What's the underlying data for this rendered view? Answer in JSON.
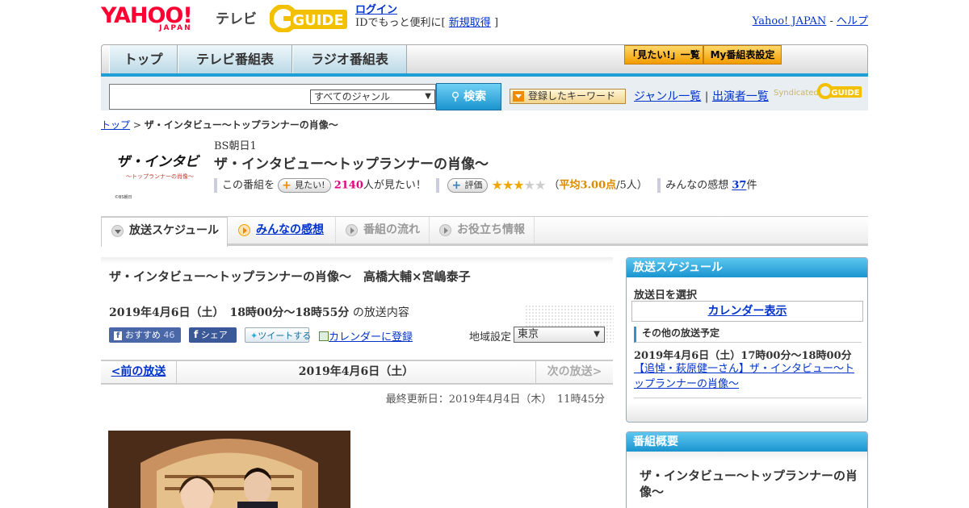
{
  "header": {
    "yahoo_logo": "YAHOO!",
    "yahoo_logo_sub": "JAPAN",
    "tv_label": "テレビ",
    "gguide_logo": "GUIDE",
    "login_link": "ログイン",
    "login_note_prefix": "IDでもっと便利に[",
    "register_link": "新規取得",
    "login_note_suffix": "]",
    "yahoo_japan_link": "Yahoo! JAPAN",
    "separator": "-",
    "help_link": "ヘルプ"
  },
  "nav": {
    "tabs": [
      "トップ",
      "テレビ番組表",
      "ラジオ番組表"
    ],
    "want_list_btn": "「見たい!」一覧",
    "my_schedule_btn": "My番組表設定"
  },
  "search": {
    "genre_selected": "すべてのジャンル",
    "search_button": "検索",
    "keyword_button": "登録したキーワード",
    "genre_list_link": "ジャンル一覧",
    "divider": "|",
    "performer_list_link": "出演者一覧",
    "syndicated": "Syndicated",
    "syndicated_logo": "GUIDE"
  },
  "breadcrumb": {
    "top": "トップ",
    "sep": ">",
    "current": "ザ・インタビュー～トップランナーの肖像～"
  },
  "program": {
    "logo_text": "ザ・インタビュー",
    "logo_sub": "〜トップランナーの肖像〜",
    "logo_corner": "©BS朝日",
    "channel": "BS朝日1",
    "title": "ザ・インタビュー～トップランナーの肖像～",
    "want_prefix": "この番組を",
    "want_button": "見たい!",
    "want_count": "2140",
    "want_suffix": "人が見たい！",
    "rate_button": "評価",
    "rating_stars": 3,
    "rating_max": 5,
    "avg_open": "（",
    "avg_label": "平均3.00点",
    "avg_people": "/5人）",
    "impressions_label": "みんなの感想",
    "impressions_count": "37",
    "impressions_unit": "件"
  },
  "tabs": [
    {
      "label": "放送スケジュール"
    },
    {
      "label": "みんなの感想"
    },
    {
      "label": "番組の流れ"
    },
    {
      "label": "お役立ち情報"
    }
  ],
  "episode": {
    "title": "ザ・インタビュー～トップランナーの肖像～　高橋大輔×宮嶋泰子",
    "date_time": "2019年4月6日（土）　18時00分～18時55分",
    "date_suffix": "の放送内容",
    "recommend_label": "おすすめ",
    "recommend_count": "46",
    "share_label": "シェア",
    "tweet_label": "ツイートする",
    "calendar_link": "カレンダーに登録",
    "region_label": "地域設定",
    "region_value": "東京"
  },
  "pager": {
    "prev": "<前の放送",
    "current": "2019年4月6日（土）",
    "next": "次の放送>"
  },
  "updated": "最終更新日：2019年4月4日（木）　11時45分",
  "sidebar": {
    "schedule_header": "放送スケジュール",
    "select_date_label": "放送日を選択",
    "calendar_button": "カレンダー表示",
    "other_header": "その他の放送予定",
    "other_date": "2019年4月6日（土）17時00分～18時00分",
    "other_link": "【追悼・萩原健一さん】ザ・インタビュー～トップランナーの肖像～",
    "overview_header": "番組概要",
    "overview_title": "ザ・インタビュー～トップランナーの肖像～"
  }
}
